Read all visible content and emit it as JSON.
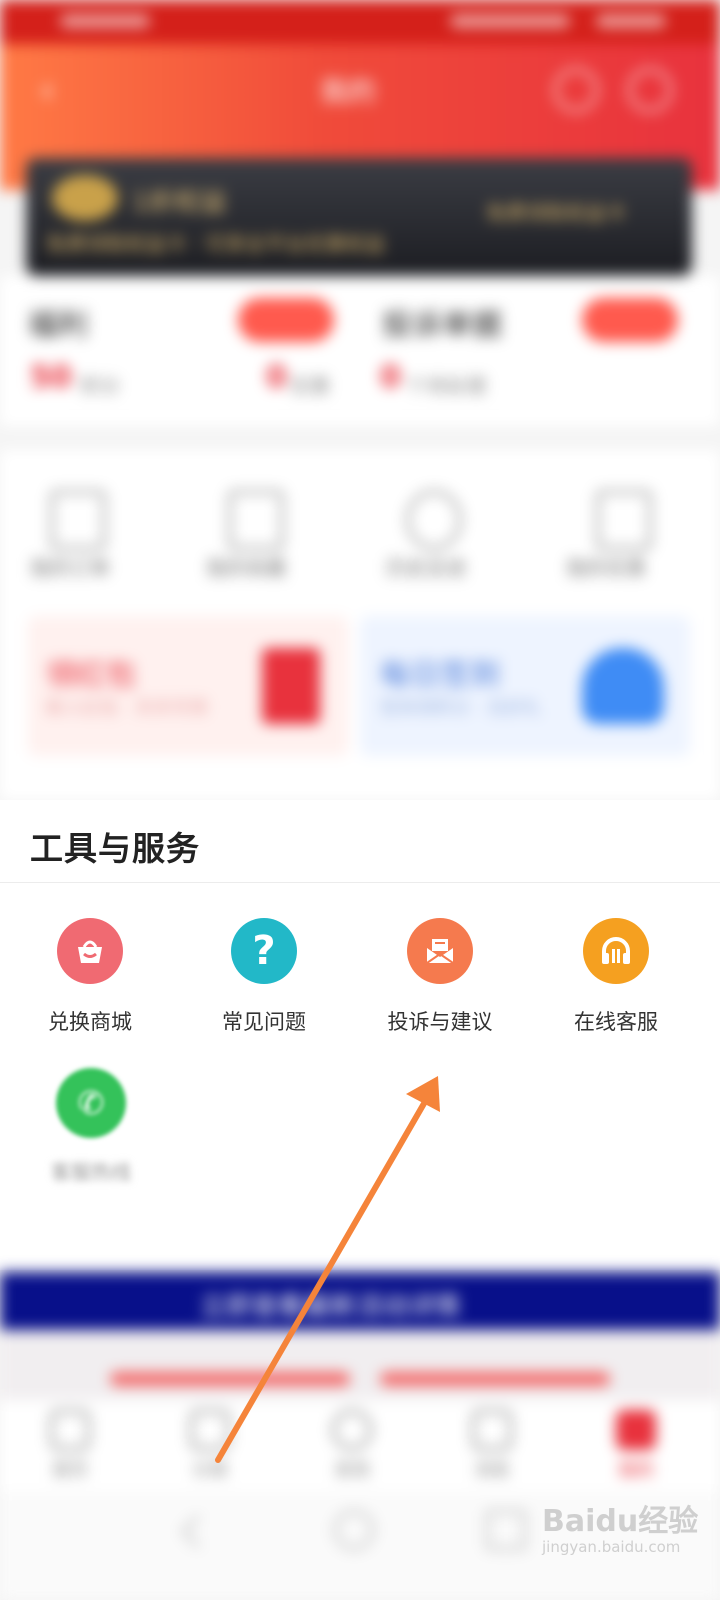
{
  "header": {
    "title": "我的",
    "bg_colors": [
      "#ff7a45",
      "#e8323d"
    ]
  },
  "vip": {
    "name": "1折权益",
    "subtitle": "免费领取权益卡 · 可享全平台优惠权益",
    "button": "免费领取权益卡"
  },
  "overview": [
    {
      "title": "福利",
      "value": "50",
      "unit": "积分"
    },
    {
      "title": "",
      "value": "0",
      "unit": "优惠"
    },
    {
      "title": "投诉单据",
      "value": "0",
      "unit": "个待处理"
    }
  ],
  "quick": [
    "我的订单",
    "我的收藏",
    "历史足迹",
    "我的优惠"
  ],
  "promos": {
    "left_title": "领红包",
    "left_sub": "新人红包 · 天天可领",
    "right_title": "每日签到",
    "right_sub": "签到领积分 · 兑好礼"
  },
  "tools": {
    "title": "工具与服务",
    "items": [
      {
        "label": "兑换商城",
        "icon": "shop-basket-icon",
        "color": "#f06a72"
      },
      {
        "label": "常见问题",
        "icon": "question-icon",
        "color": "#22b8c8"
      },
      {
        "label": "投诉与建议",
        "icon": "mail-icon",
        "color": "#f57a4e"
      },
      {
        "label": "在线客服",
        "icon": "headset-icon",
        "color": "#f5a020"
      }
    ],
    "extra": {
      "label": "客服热线",
      "icon": "phone-icon",
      "color": "#34c25a"
    }
  },
  "banner": {
    "text": "立即查看最新活动详情"
  },
  "tabs": [
    "首页",
    "分类",
    "发现",
    "消息",
    "我的"
  ],
  "annotation": {
    "color": "#f5843a"
  },
  "watermark": {
    "main": "Baidu经验",
    "sub": "jingyan.baidu.com"
  }
}
